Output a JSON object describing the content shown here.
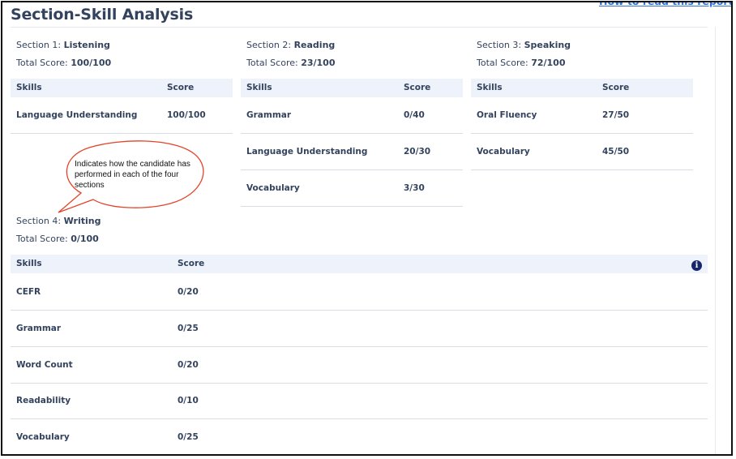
{
  "page": {
    "title": "Section-Skill Analysis",
    "report_link": "How to read this report?"
  },
  "colors": {
    "accent": "#15266b",
    "link": "#2f6fd6",
    "callout_border": "#e2442a",
    "header_bg": "#eef3fb"
  },
  "callout": {
    "text": "Indicates how the candidate has performed in each of the four sections"
  },
  "sections": [
    {
      "prefix": "Section 1:",
      "name": "Listening",
      "score_label": "Total Score:",
      "score": "100/100",
      "col_skill": "Skills",
      "col_score": "Score",
      "rows": [
        {
          "skill": "Language Understanding",
          "score": "100/100"
        }
      ]
    },
    {
      "prefix": "Section 2:",
      "name": "Reading",
      "score_label": "Total Score:",
      "score": "23/100",
      "col_skill": "Skills",
      "col_score": "Score",
      "rows": [
        {
          "skill": "Grammar",
          "score": "0/40"
        },
        {
          "skill": "Language Understanding",
          "score": "20/30"
        },
        {
          "skill": "Vocabulary",
          "score": "3/30"
        }
      ]
    },
    {
      "prefix": "Section 3:",
      "name": "Speaking",
      "score_label": "Total Score:",
      "score": "72/100",
      "col_skill": "Skills",
      "col_score": "Score",
      "rows": [
        {
          "skill": "Oral Fluency",
          "score": "27/50"
        },
        {
          "skill": "Vocabulary",
          "score": "45/50"
        }
      ]
    },
    {
      "prefix": "Section 4:",
      "name": "Writing",
      "score_label": "Total Score:",
      "score": "0/100",
      "col_skill": "Skills",
      "col_score": "Score",
      "rows": [
        {
          "skill": "CEFR",
          "score": "0/20"
        },
        {
          "skill": "Grammar",
          "score": "0/25"
        },
        {
          "skill": "Word Count",
          "score": "0/20"
        },
        {
          "skill": "Readability",
          "score": "0/10"
        },
        {
          "skill": "Vocabulary",
          "score": "0/25"
        }
      ]
    }
  ],
  "info_icon": {
    "glyph": "i",
    "icon": "info-icon"
  }
}
